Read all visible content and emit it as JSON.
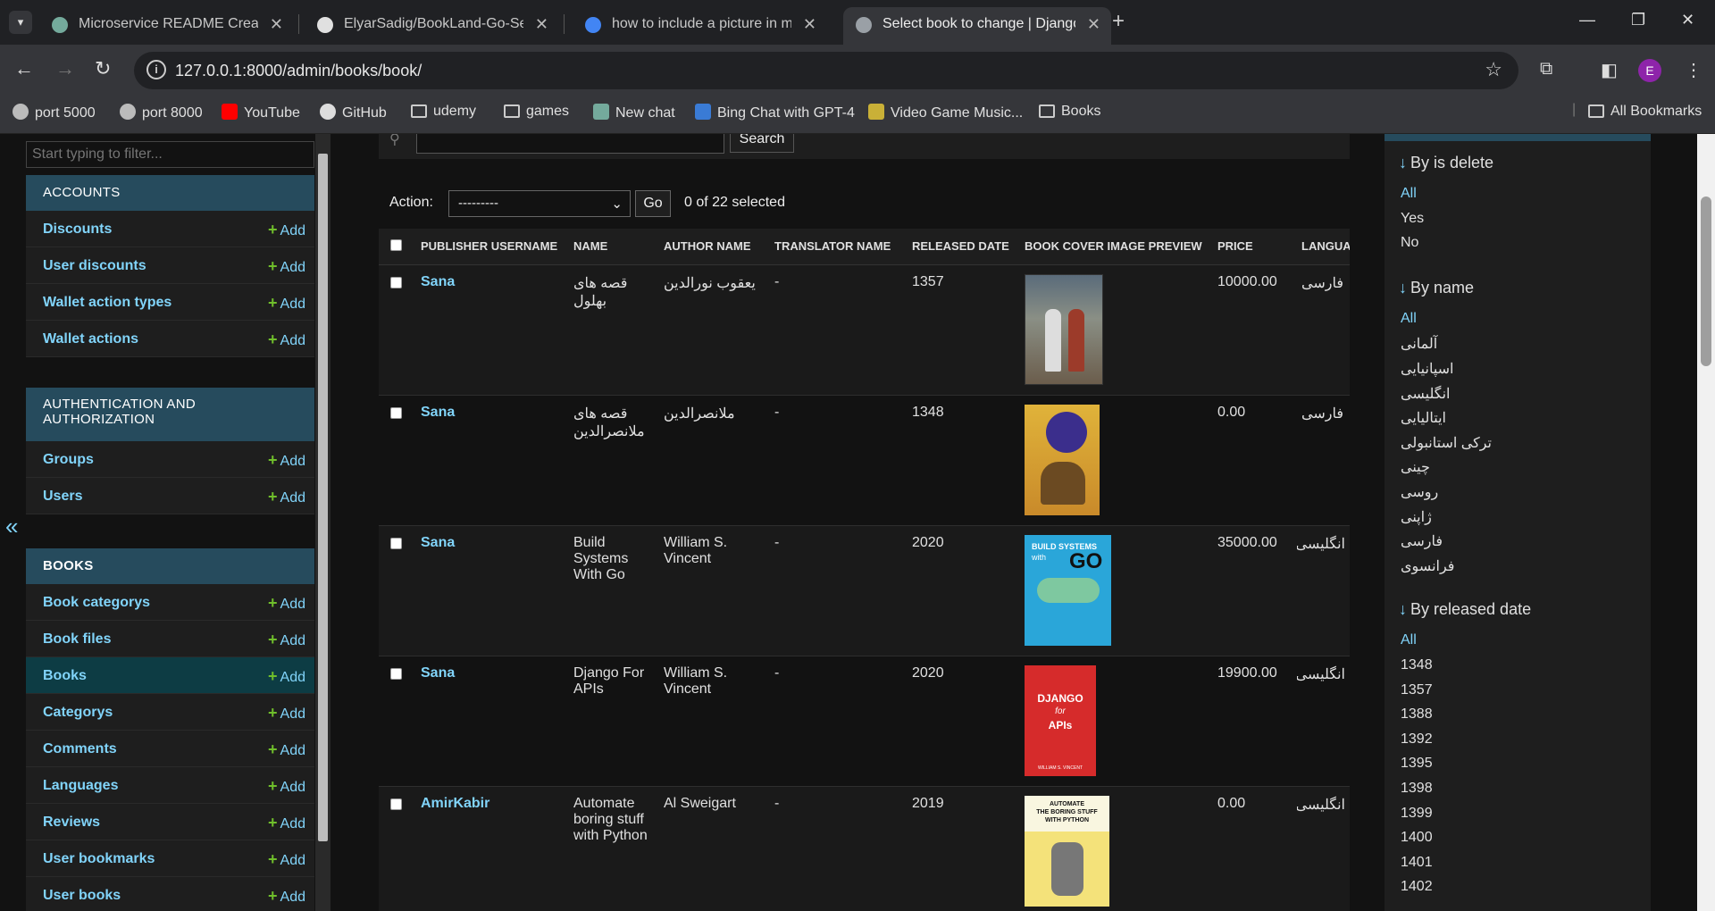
{
  "browser": {
    "tabs": [
      {
        "label": "Microservice README Creation",
        "color": "#74aa9c"
      },
      {
        "label": "ElyarSadig/BookLand-Go-Search",
        "color": "#e0e0e0"
      },
      {
        "label": "how to include a picture in mar",
        "color": "#4285f4"
      },
      {
        "label": "Select book to change | Django",
        "color": "#9aa0a6"
      }
    ],
    "url": "127.0.0.1:8000/admin/books/book/",
    "profile_initial": "E",
    "bookmarks": [
      {
        "label": "port 5000",
        "icon": "globe-icon"
      },
      {
        "label": "port 8000",
        "icon": "globe-icon"
      },
      {
        "label": "YouTube",
        "icon": "youtube-icon"
      },
      {
        "label": "GitHub",
        "icon": "github-icon"
      },
      {
        "label": "udemy",
        "icon": "folder-icon"
      },
      {
        "label": "games",
        "icon": "folder-icon"
      },
      {
        "label": "New chat",
        "icon": "openai-icon"
      },
      {
        "label": "Bing Chat with GPT-4",
        "icon": "bing-icon"
      },
      {
        "label": "Video Game Music...",
        "icon": "music-icon"
      },
      {
        "label": "Books",
        "icon": "folder-icon"
      }
    ],
    "all_bookmarks": "All Bookmarks"
  },
  "sidebar": {
    "filter_placeholder": "Start typing to filter...",
    "modules": [
      {
        "title": "ACCOUNTS",
        "items": [
          "Discounts",
          "User discounts",
          "Wallet action types",
          "Wallet actions"
        ]
      },
      {
        "title": "AUTHENTICATION AND AUTHORIZATION",
        "items": [
          "Groups",
          "Users"
        ]
      },
      {
        "title": "BOOKS",
        "items": [
          "Book categorys",
          "Book files",
          "Books",
          "Categorys",
          "Comments",
          "Languages",
          "Reviews",
          "User bookmarks",
          "User books"
        ]
      }
    ],
    "add_label": "Add",
    "toggle": "«"
  },
  "changelist": {
    "search_button": "Search",
    "action_label": "Action:",
    "action_value": "---------",
    "go_label": "Go",
    "selected_count": "0 of 22 selected",
    "columns": [
      "PUBLISHER USERNAME",
      "NAME",
      "AUTHOR NAME",
      "TRANSLATOR NAME",
      "RELEASED DATE",
      "BOOK COVER IMAGE PREVIEW",
      "PRICE",
      "LANGUAGE"
    ],
    "rows": [
      {
        "publisher": "Sana",
        "name": "قصه های بهلول",
        "author": "یعقوب نورالدین",
        "translator": "-",
        "released": "1357",
        "price": "10000.00",
        "language": "فارسی",
        "cover": "old"
      },
      {
        "publisher": "Sana",
        "name": "قصه های ملانصرالدین",
        "author": "ملانصرالدین",
        "translator": "-",
        "released": "1348",
        "price": "0.00",
        "language": "فارسی",
        "cover": "mulla"
      },
      {
        "publisher": "Sana",
        "name": "Build Systems With Go",
        "author": "William S. Vincent",
        "translator": "-",
        "released": "2020",
        "price": "35000.00",
        "language": "انگلیسی",
        "cover": "go"
      },
      {
        "publisher": "Sana",
        "name": "Django For APIs",
        "author": "William S. Vincent",
        "translator": "-",
        "released": "2020",
        "price": "19900.00",
        "language": "انگلیسی",
        "cover": "django"
      },
      {
        "publisher": "AmirKabir",
        "name": "Automate boring stuff with Python",
        "author": "Al Sweigart",
        "translator": "-",
        "released": "2019",
        "price": "0.00",
        "language": "انگلیسی",
        "cover": "python"
      }
    ],
    "cover_texts": {
      "go": [
        "BUILD SYSTEMS",
        "with",
        "GO"
      ],
      "django": [
        "DJANGO",
        "for",
        "APIs",
        "WILLIAM S. VINCENT"
      ],
      "python": [
        "AUTOMATE",
        "THE BORING STUFF",
        "WITH PYTHON"
      ]
    }
  },
  "filters": [
    {
      "title": "By is delete",
      "options": [
        "All",
        "Yes",
        "No"
      ]
    },
    {
      "title": "By name",
      "options": [
        "All",
        "آلمانی",
        "اسپانیایی",
        "انگلیسی",
        "ایتالیایی",
        "ترکی استانبولی",
        "چینی",
        "روسی",
        "ژاپنی",
        "فارسی",
        "فرانسوی"
      ]
    },
    {
      "title": "By released date",
      "options": [
        "All",
        "1348",
        "1357",
        "1388",
        "1392",
        "1395",
        "1398",
        "1399",
        "1400",
        "1401",
        "1402"
      ]
    }
  ],
  "colors": {
    "accent": "#81d4fa",
    "module_header": "#264b5d",
    "add_plus": "#70bf2b",
    "current_row": "#0d3c44"
  }
}
